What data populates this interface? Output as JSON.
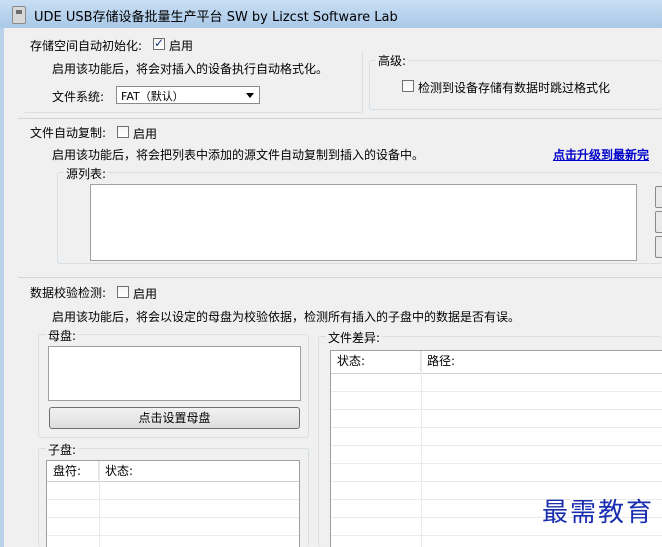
{
  "window": {
    "title": "UDE USB存储设备批量生产平台 SW    by Lizcst Software Lab"
  },
  "auto_format": {
    "label": "存储空间自动初始化:",
    "enable_label": "启用",
    "enabled": true,
    "description": "启用该功能后，将会对插入的设备执行自动格式化。",
    "fs_label": "文件系统:",
    "fs_value": "FAT（默认）"
  },
  "advanced": {
    "label": "高级:",
    "skip_label": "检测到设备存储有数据时跳过格式化",
    "skip_checked": false
  },
  "auto_copy": {
    "label": "文件自动复制:",
    "enable_label": "启用",
    "enabled": false,
    "description": "启用该功能后，将会把列表中添加的源文件自动复制到插入的设备中。",
    "upgrade_link": "点击升级到最新完",
    "source_list_label": "源列表:"
  },
  "verify": {
    "label": "数据校验检测:",
    "enable_label": "启用",
    "enabled": false,
    "description": "启用该功能后，将会以设定的母盘为校验依据，检测所有插入的子盘中的数据是否有误。",
    "master_label": "母盘:",
    "set_master_button": "点击设置母盘",
    "child_label": "子盘:",
    "child_columns": [
      "盘符:",
      "状态:"
    ],
    "diff_label": "文件差异:",
    "diff_columns": [
      "状态:",
      "路径:"
    ]
  },
  "watermark": "最需教育"
}
